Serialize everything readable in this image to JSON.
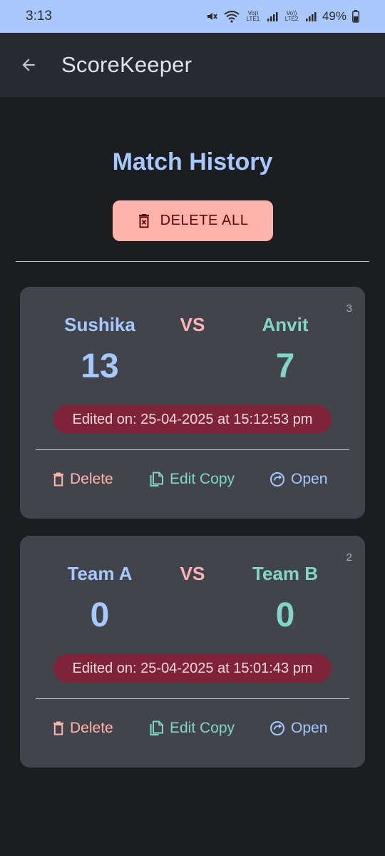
{
  "status_bar": {
    "time": "3:13",
    "battery": "49%",
    "sim1_label": "Vo)) LTE1",
    "sim2_label": "Vo)) LTE2",
    "icons": [
      "mute-icon",
      "wifi-icon",
      "signal-icon",
      "battery-icon"
    ]
  },
  "app_bar": {
    "title": "ScoreKeeper",
    "back_icon": "arrow-back-icon"
  },
  "page": {
    "title": "Match History",
    "delete_all_label": "DELETE ALL"
  },
  "matches": [
    {
      "number": "3",
      "team_a": "Sushika",
      "vs": "VS",
      "team_b": "Anvit",
      "score_a": "13",
      "score_b": "7",
      "edited": "Edited on: 25-04-2025 at 15:12:53 pm",
      "actions": {
        "delete": "Delete",
        "edit_copy": "Edit Copy",
        "open": "Open"
      }
    },
    {
      "number": "2",
      "team_a": "Team A",
      "vs": "VS",
      "team_b": "Team B",
      "score_a": "0",
      "score_b": "0",
      "edited": "Edited on: 25-04-2025 at 15:01:43 pm",
      "actions": {
        "delete": "Delete",
        "edit_copy": "Edit Copy",
        "open": "Open"
      }
    }
  ],
  "colors": {
    "status_bar": "#a9c8fb",
    "app_bar": "#272a30",
    "background": "#1c1d1f",
    "card": "#41444b",
    "primary": "#a6c8ff",
    "vs": "#ffb3b8",
    "tertiary": "#82d5c8",
    "edited_badge": "#7f2438",
    "delete_all_bg": "#ffb4ab"
  }
}
